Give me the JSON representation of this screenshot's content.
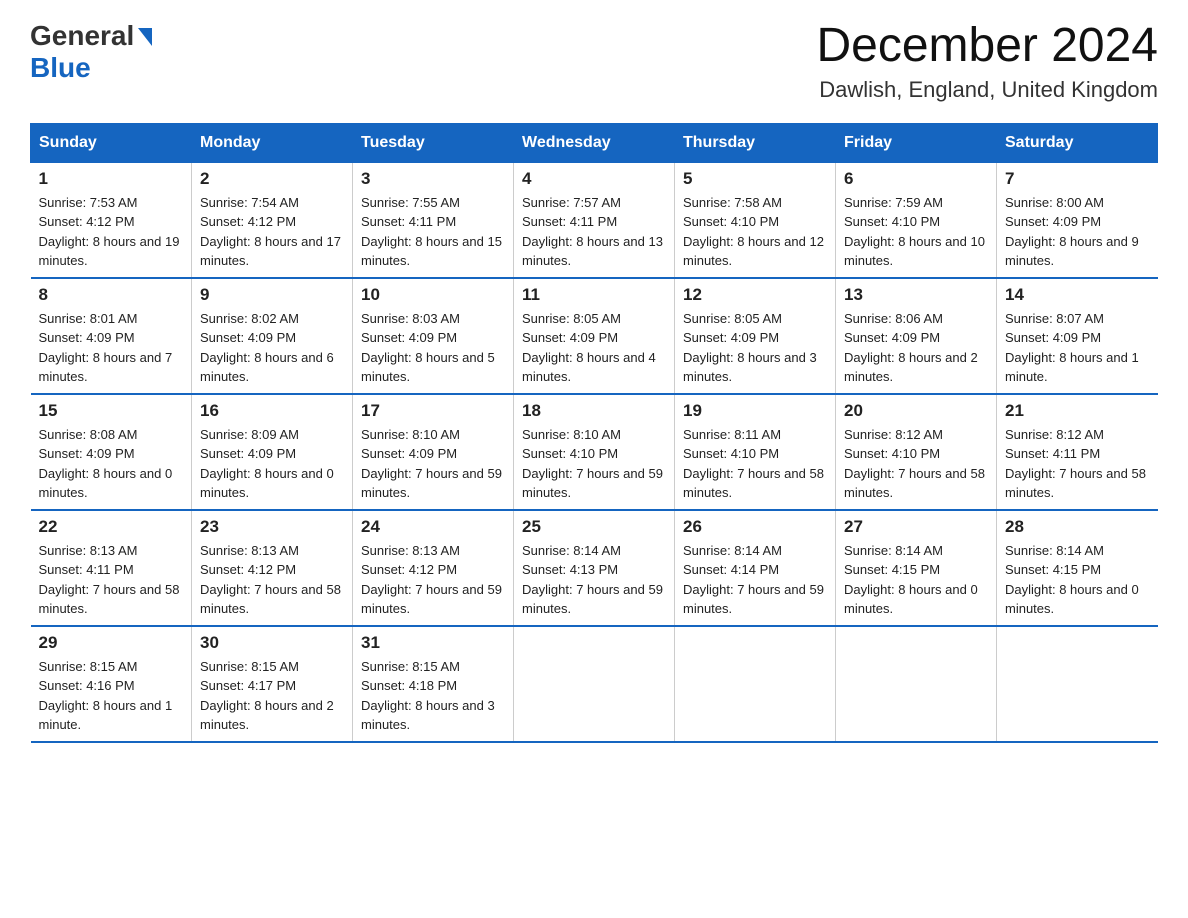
{
  "header": {
    "logo_general": "General",
    "logo_blue": "Blue",
    "month_year": "December 2024",
    "location": "Dawlish, England, United Kingdom"
  },
  "days_of_week": [
    "Sunday",
    "Monday",
    "Tuesday",
    "Wednesday",
    "Thursday",
    "Friday",
    "Saturday"
  ],
  "weeks": [
    [
      {
        "day": "1",
        "sunrise": "7:53 AM",
        "sunset": "4:12 PM",
        "daylight": "8 hours and 19 minutes."
      },
      {
        "day": "2",
        "sunrise": "7:54 AM",
        "sunset": "4:12 PM",
        "daylight": "8 hours and 17 minutes."
      },
      {
        "day": "3",
        "sunrise": "7:55 AM",
        "sunset": "4:11 PM",
        "daylight": "8 hours and 15 minutes."
      },
      {
        "day": "4",
        "sunrise": "7:57 AM",
        "sunset": "4:11 PM",
        "daylight": "8 hours and 13 minutes."
      },
      {
        "day": "5",
        "sunrise": "7:58 AM",
        "sunset": "4:10 PM",
        "daylight": "8 hours and 12 minutes."
      },
      {
        "day": "6",
        "sunrise": "7:59 AM",
        "sunset": "4:10 PM",
        "daylight": "8 hours and 10 minutes."
      },
      {
        "day": "7",
        "sunrise": "8:00 AM",
        "sunset": "4:09 PM",
        "daylight": "8 hours and 9 minutes."
      }
    ],
    [
      {
        "day": "8",
        "sunrise": "8:01 AM",
        "sunset": "4:09 PM",
        "daylight": "8 hours and 7 minutes."
      },
      {
        "day": "9",
        "sunrise": "8:02 AM",
        "sunset": "4:09 PM",
        "daylight": "8 hours and 6 minutes."
      },
      {
        "day": "10",
        "sunrise": "8:03 AM",
        "sunset": "4:09 PM",
        "daylight": "8 hours and 5 minutes."
      },
      {
        "day": "11",
        "sunrise": "8:05 AM",
        "sunset": "4:09 PM",
        "daylight": "8 hours and 4 minutes."
      },
      {
        "day": "12",
        "sunrise": "8:05 AM",
        "sunset": "4:09 PM",
        "daylight": "8 hours and 3 minutes."
      },
      {
        "day": "13",
        "sunrise": "8:06 AM",
        "sunset": "4:09 PM",
        "daylight": "8 hours and 2 minutes."
      },
      {
        "day": "14",
        "sunrise": "8:07 AM",
        "sunset": "4:09 PM",
        "daylight": "8 hours and 1 minute."
      }
    ],
    [
      {
        "day": "15",
        "sunrise": "8:08 AM",
        "sunset": "4:09 PM",
        "daylight": "8 hours and 0 minutes."
      },
      {
        "day": "16",
        "sunrise": "8:09 AM",
        "sunset": "4:09 PM",
        "daylight": "8 hours and 0 minutes."
      },
      {
        "day": "17",
        "sunrise": "8:10 AM",
        "sunset": "4:09 PM",
        "daylight": "7 hours and 59 minutes."
      },
      {
        "day": "18",
        "sunrise": "8:10 AM",
        "sunset": "4:10 PM",
        "daylight": "7 hours and 59 minutes."
      },
      {
        "day": "19",
        "sunrise": "8:11 AM",
        "sunset": "4:10 PM",
        "daylight": "7 hours and 58 minutes."
      },
      {
        "day": "20",
        "sunrise": "8:12 AM",
        "sunset": "4:10 PM",
        "daylight": "7 hours and 58 minutes."
      },
      {
        "day": "21",
        "sunrise": "8:12 AM",
        "sunset": "4:11 PM",
        "daylight": "7 hours and 58 minutes."
      }
    ],
    [
      {
        "day": "22",
        "sunrise": "8:13 AM",
        "sunset": "4:11 PM",
        "daylight": "7 hours and 58 minutes."
      },
      {
        "day": "23",
        "sunrise": "8:13 AM",
        "sunset": "4:12 PM",
        "daylight": "7 hours and 58 minutes."
      },
      {
        "day": "24",
        "sunrise": "8:13 AM",
        "sunset": "4:12 PM",
        "daylight": "7 hours and 59 minutes."
      },
      {
        "day": "25",
        "sunrise": "8:14 AM",
        "sunset": "4:13 PM",
        "daylight": "7 hours and 59 minutes."
      },
      {
        "day": "26",
        "sunrise": "8:14 AM",
        "sunset": "4:14 PM",
        "daylight": "7 hours and 59 minutes."
      },
      {
        "day": "27",
        "sunrise": "8:14 AM",
        "sunset": "4:15 PM",
        "daylight": "8 hours and 0 minutes."
      },
      {
        "day": "28",
        "sunrise": "8:14 AM",
        "sunset": "4:15 PM",
        "daylight": "8 hours and 0 minutes."
      }
    ],
    [
      {
        "day": "29",
        "sunrise": "8:15 AM",
        "sunset": "4:16 PM",
        "daylight": "8 hours and 1 minute."
      },
      {
        "day": "30",
        "sunrise": "8:15 AM",
        "sunset": "4:17 PM",
        "daylight": "8 hours and 2 minutes."
      },
      {
        "day": "31",
        "sunrise": "8:15 AM",
        "sunset": "4:18 PM",
        "daylight": "8 hours and 3 minutes."
      },
      null,
      null,
      null,
      null
    ]
  ]
}
